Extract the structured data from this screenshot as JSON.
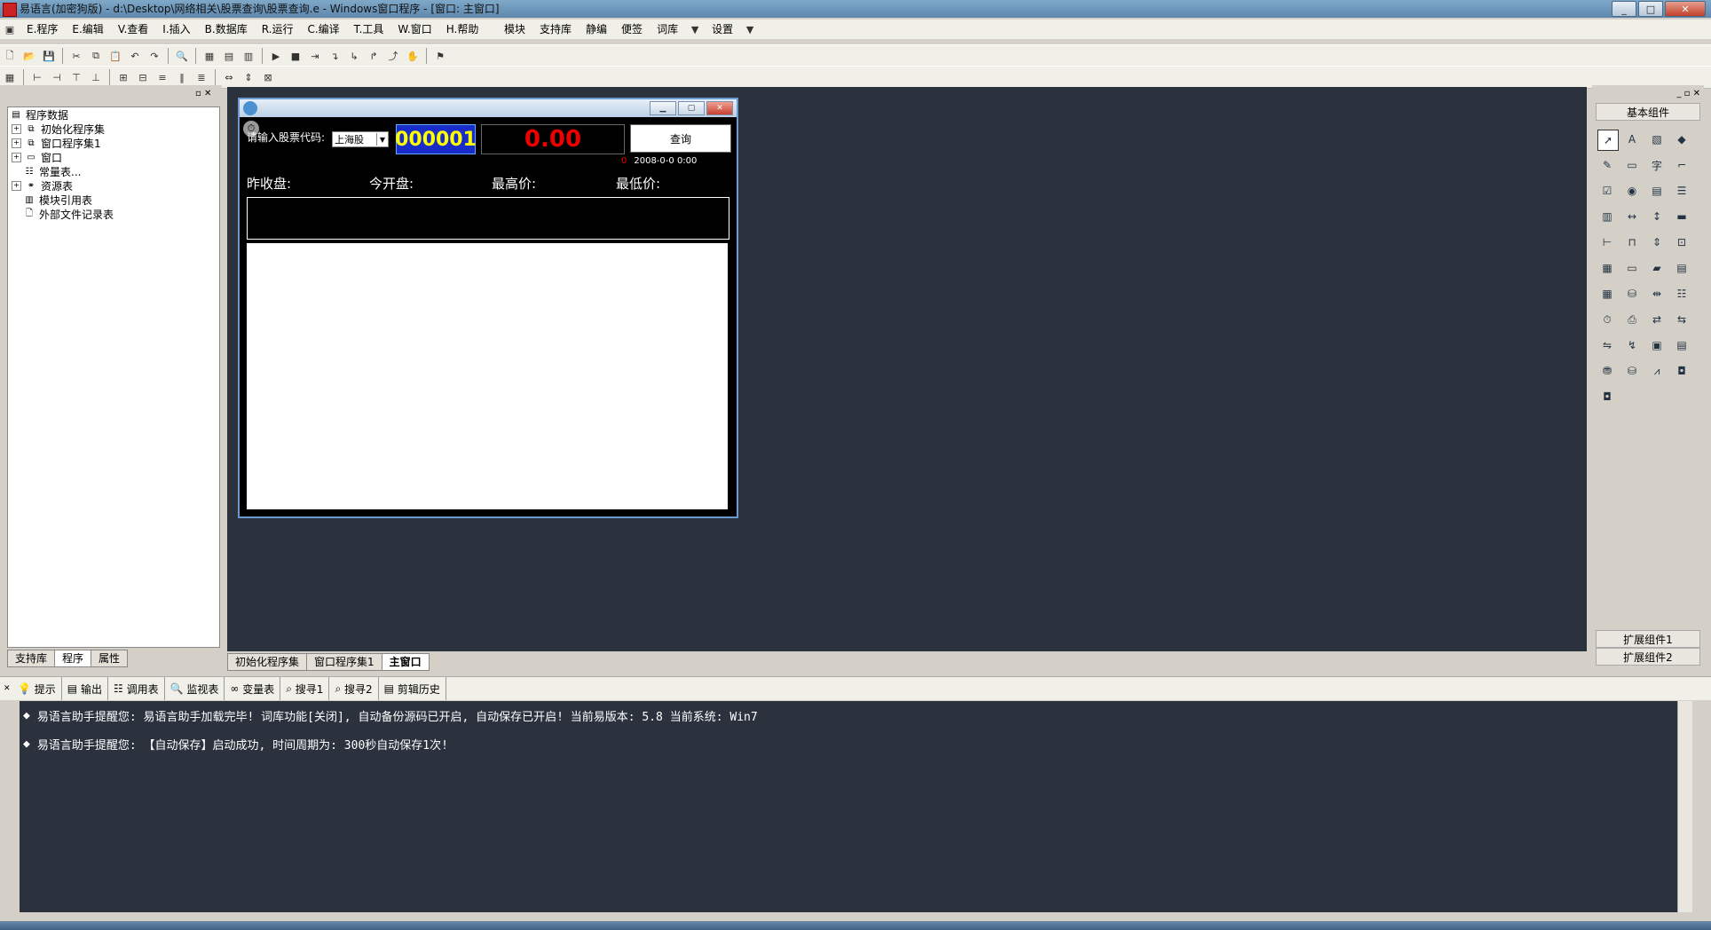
{
  "window": {
    "title": "易语言(加密狗版) - d:\\Desktop\\网络相关\\股票查询\\股票查询.e - Windows窗口程序 - [窗口: 主窗口]"
  },
  "menubar": {
    "items": [
      "E.程序",
      "E.编辑",
      "V.查看",
      "I.插入",
      "B.数据库",
      "R.运行",
      "C.编译",
      "T.工具",
      "W.窗口",
      "H.帮助"
    ],
    "right_items": [
      "模块",
      "支持库",
      "静编",
      "便签",
      "词库",
      "设置"
    ]
  },
  "left_panel": {
    "tree": [
      {
        "label": "程序数据",
        "depth": 0
      },
      {
        "label": "初始化程序集",
        "depth": 1
      },
      {
        "label": "窗口程序集1",
        "depth": 1
      },
      {
        "label": "窗口",
        "depth": 1
      },
      {
        "label": "常量表...",
        "depth": 1
      },
      {
        "label": "资源表",
        "depth": 1
      },
      {
        "label": "模块引用表",
        "depth": 1
      },
      {
        "label": "外部文件记录表",
        "depth": 1
      }
    ],
    "tabs": [
      "支持库",
      "程序",
      "属性"
    ]
  },
  "form": {
    "stock_label": "请输入股票代码:",
    "market": "上海股",
    "code": "000001",
    "price": "0.00",
    "query_button": "查询",
    "timestamp_zero": "0",
    "timestamp": "2008-0-0 0:00",
    "labels": [
      "昨收盘:",
      "今开盘:",
      "最高价:",
      "最低价:"
    ]
  },
  "doc_tabs": [
    "初始化程序集",
    "窗口程序集1",
    "主窗口"
  ],
  "palette": {
    "title": "基本组件",
    "ext1": "扩展组件1",
    "ext2": "扩展组件2"
  },
  "output_tabs": [
    "提示",
    "输出",
    "调用表",
    "监视表",
    "变量表",
    "搜寻1",
    "搜寻2",
    "剪辑历史"
  ],
  "output_lines": [
    "易语言助手提醒您:  易语言助手加载完毕! 词库功能[关闭], 自动备份源码已开启, 自动保存已开启!  当前易版本: 5.8  当前系统: Win7",
    "易语言助手提醒您: 【自动保存】启动成功, 时间周期为: 300秒自动保存1次!"
  ],
  "colors": {
    "design_bg": "#2b313d",
    "code_bg": "#1a2cc8",
    "code_fg": "#ffff00",
    "price_fg": "#ee0000"
  }
}
